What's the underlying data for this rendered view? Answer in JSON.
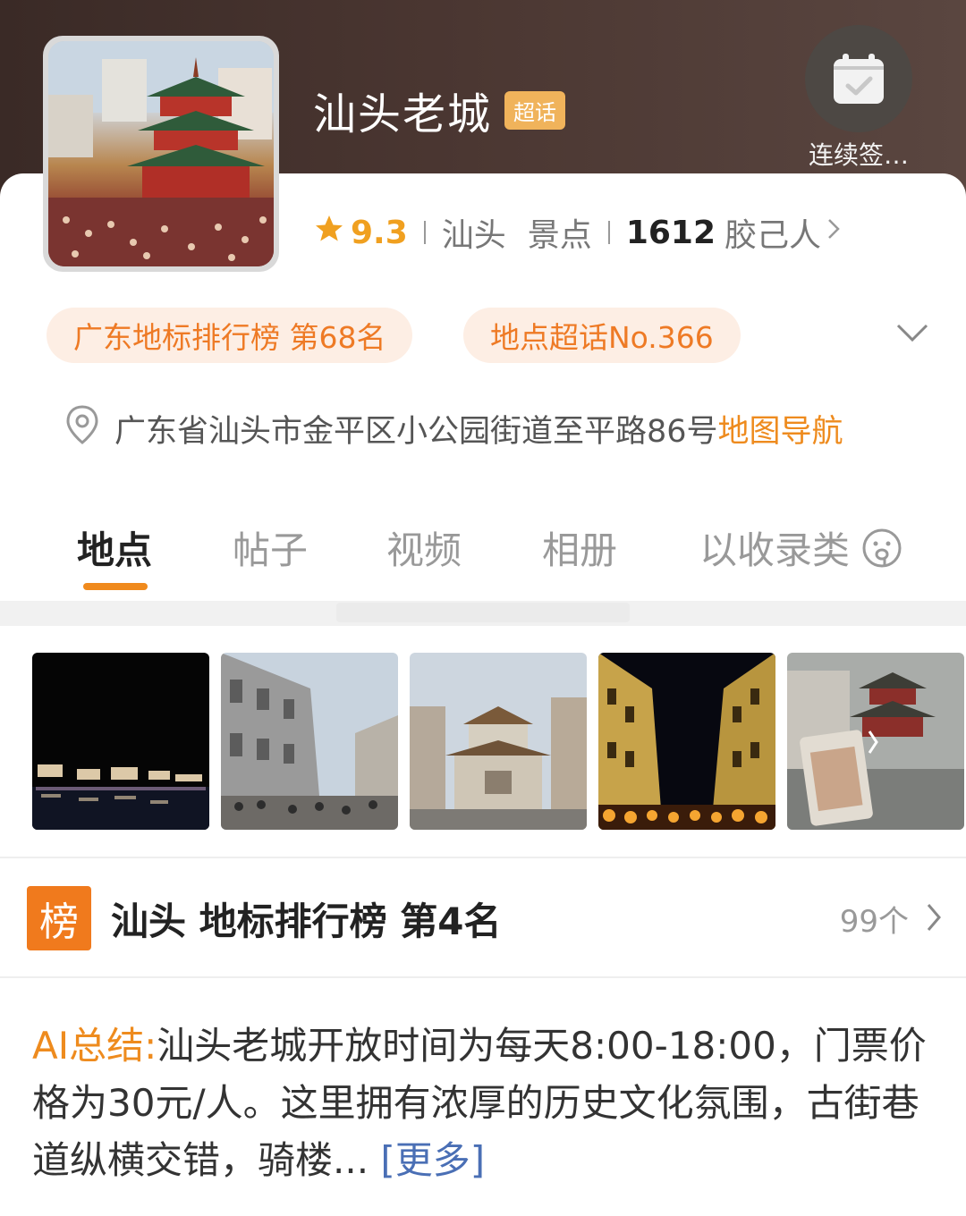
{
  "header": {
    "title": "汕头老城",
    "badge": "超话",
    "checkin_label": "连续签…",
    "rating": "9.3",
    "city": "汕头",
    "type": "景点",
    "followers_count": "1612",
    "followers_unit": "胶己人"
  },
  "tags": [
    {
      "label": "广东地标排行榜 第68名"
    },
    {
      "label": "地点超话No.366"
    }
  ],
  "address": {
    "text": "广东省汕头市金平区小公园街道至平路86号",
    "nav_label": "地图导航"
  },
  "tabs": [
    {
      "label": "地点",
      "active": true
    },
    {
      "label": "帖子"
    },
    {
      "label": "视频"
    },
    {
      "label": "相册"
    },
    {
      "label": "以收录类"
    }
  ],
  "photos": [
    {
      "desc": "night-river-pavilions"
    },
    {
      "desc": "arcade-street-day"
    },
    {
      "desc": "memorial-gate"
    },
    {
      "desc": "night-street-lanterns"
    },
    {
      "desc": "pagoda-rainy-day"
    }
  ],
  "ranking": {
    "icon_label": "榜",
    "title": "汕头 地标排行榜 第4名",
    "count": "99个"
  },
  "ai_summary": {
    "label": "AI总结:",
    "text": "汕头老城开放时间为每天8:00-18:00，门票价格为30元/人。这里拥有浓厚的历史文化氛围，古街巷道纵横交错，骑楼...",
    "more": "[更多]"
  },
  "colors": {
    "accent": "#ee8b1e",
    "rating": "#f0a020",
    "tag_bg": "#fdeee4",
    "link": "#4a6fb5"
  }
}
